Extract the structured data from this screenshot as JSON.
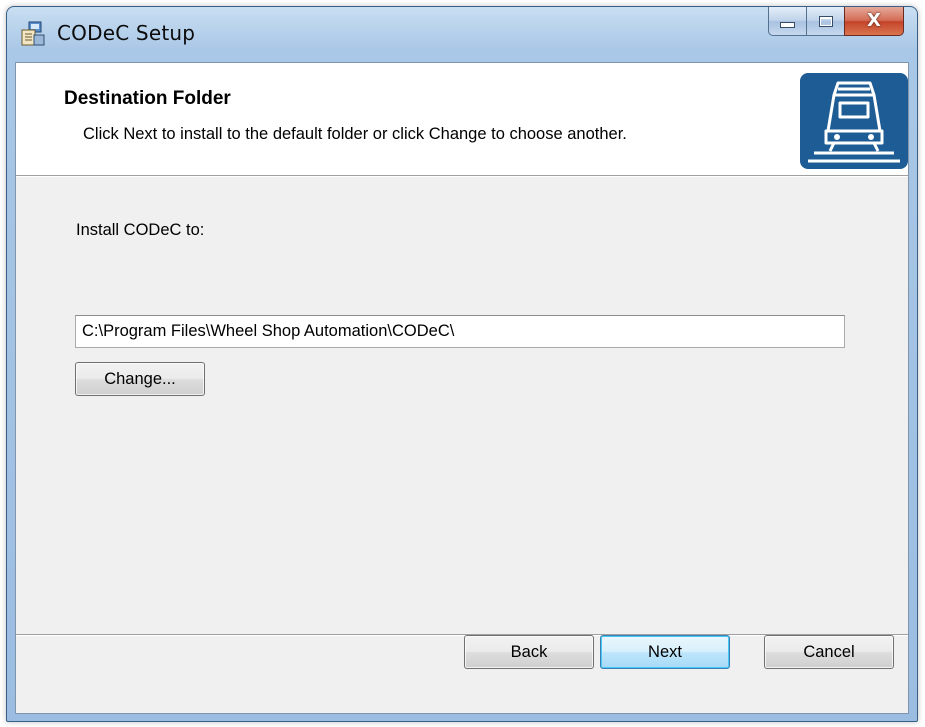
{
  "window": {
    "title": "CODeC Setup",
    "controls": {
      "minimize": "minimize",
      "maximize": "maximize",
      "close": "X"
    }
  },
  "banner": {
    "title": "Destination Folder",
    "description": "Click Next to install to the default folder or click Change to choose another.",
    "logo_icon": "train-icon"
  },
  "main": {
    "install_label": "Install CODeC to:",
    "path_value": "C:\\Program Files\\Wheel Shop Automation\\CODeC\\",
    "change_button": "Change..."
  },
  "footer": {
    "back_button": "Back",
    "next_button": "Next",
    "cancel_button": "Cancel"
  },
  "colors": {
    "logo_background": "#1e5c95",
    "dialog_background": "#f0f0f0",
    "banner_background": "#ffffff",
    "close_button": "#c4432a"
  }
}
